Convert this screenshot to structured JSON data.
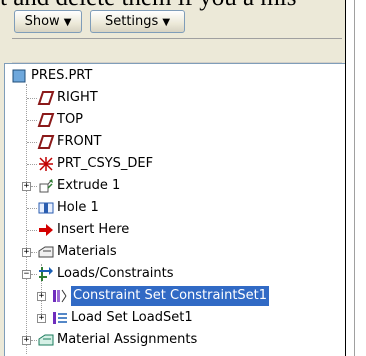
{
  "top_text": "t and delete them if you a mis",
  "toolbar": {
    "show_label": "Show",
    "settings_label": "Settings"
  },
  "tree": {
    "root": "PRES.PRT",
    "items": [
      {
        "label": "RIGHT"
      },
      {
        "label": "TOP"
      },
      {
        "label": "FRONT"
      },
      {
        "label": "PRT_CSYS_DEF"
      },
      {
        "label": "Extrude 1"
      },
      {
        "label": "Hole 1"
      },
      {
        "label": "Insert Here"
      },
      {
        "label": "Materials"
      },
      {
        "label": "Loads/Constraints"
      },
      {
        "label": "Constraint Set ConstraintSet1"
      },
      {
        "label": "Load Set LoadSet1"
      },
      {
        "label": "Material Assignments"
      }
    ]
  },
  "colors": {
    "selection": "#316ac5",
    "datum_plane": "#8b1a1a",
    "insert_arrow": "#d40000",
    "constraint": "#6f2dbd"
  }
}
